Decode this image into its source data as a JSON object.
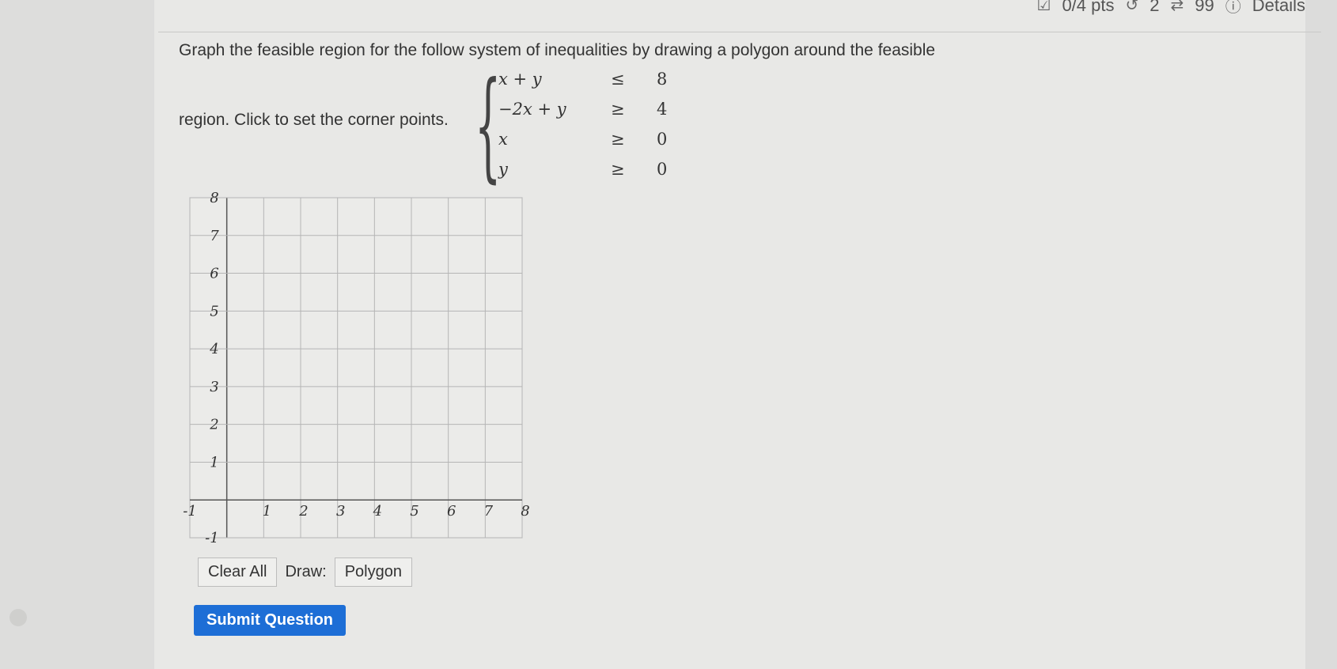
{
  "status_bar": {
    "points": "0/4 pts",
    "retries": "2",
    "submissions": "99",
    "details": "Details"
  },
  "question": {
    "line1": "Graph the feasible region for the follow system of inequalities by drawing a polygon around the feasible",
    "line2": "region. Click to set the corner points."
  },
  "inequalities": [
    {
      "lhs": "x + y",
      "op": "≤",
      "rhs": "8"
    },
    {
      "lhs": "−2x + y",
      "op": "≥",
      "rhs": "4"
    },
    {
      "lhs": "x",
      "op": "≥",
      "rhs": "0"
    },
    {
      "lhs": "y",
      "op": "≥",
      "rhs": "0"
    }
  ],
  "graph": {
    "x_range": [
      -1,
      8
    ],
    "y_range": [
      -1,
      8
    ],
    "x_ticks": [
      "-1",
      "1",
      "2",
      "3",
      "4",
      "5",
      "6",
      "7",
      "8"
    ],
    "y_ticks": [
      "8",
      "7",
      "6",
      "5",
      "4",
      "3",
      "2",
      "1",
      "-1"
    ]
  },
  "controls": {
    "clear_all": "Clear All",
    "draw_label": "Draw:",
    "polygon": "Polygon"
  },
  "submit_label": "Submit Question"
}
